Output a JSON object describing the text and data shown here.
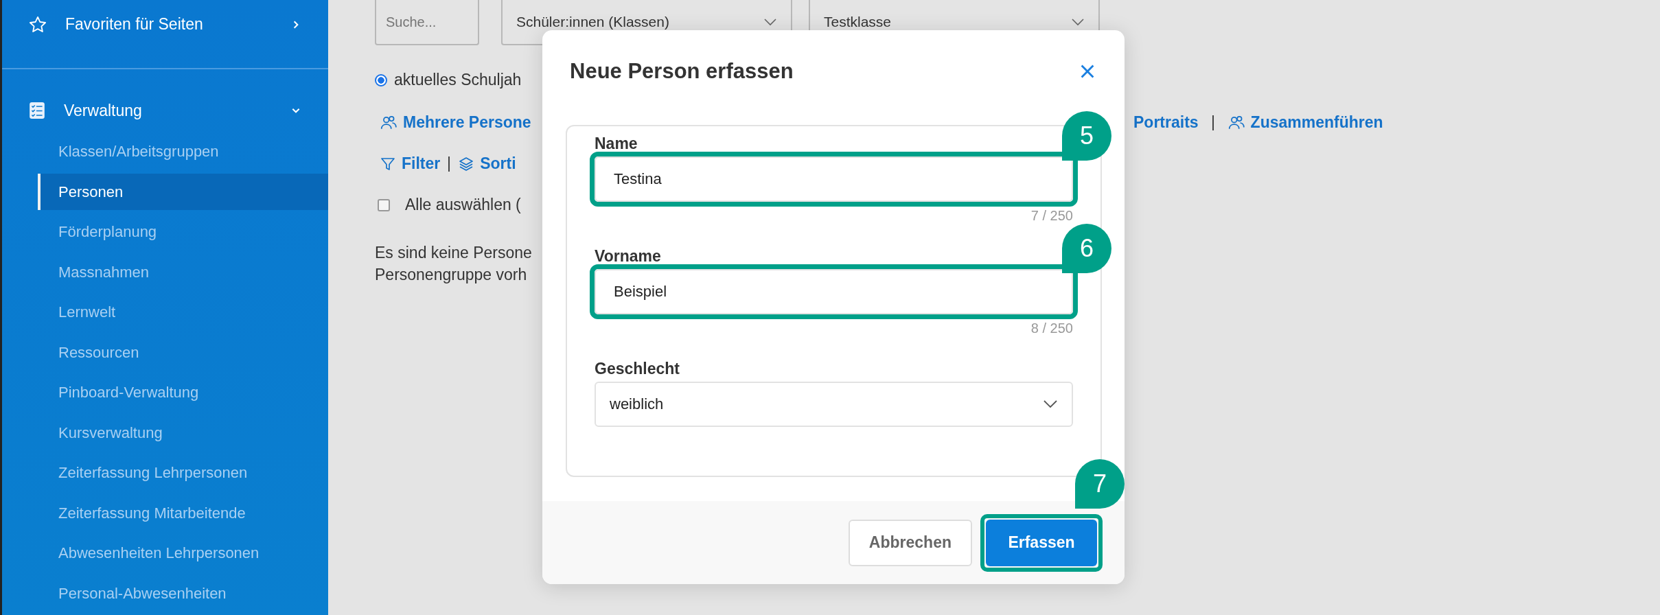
{
  "sidebar": {
    "groups": [
      {
        "label": "Favoriten für Seiten",
        "expanded": false
      },
      {
        "label": "Verwaltung",
        "expanded": true,
        "items": [
          {
            "label": "Klassen/Arbeitsgruppen",
            "selected": false
          },
          {
            "label": "Personen",
            "selected": true
          },
          {
            "label": "Förderplanung",
            "selected": false
          },
          {
            "label": "Massnahmen",
            "selected": false
          },
          {
            "label": "Lernwelt",
            "selected": false
          },
          {
            "label": "Ressourcen",
            "selected": false
          },
          {
            "label": "Pinboard-Verwaltung",
            "selected": false
          },
          {
            "label": "Kursverwaltung",
            "selected": false
          },
          {
            "label": "Zeiterfassung Lehrpersonen",
            "selected": false
          },
          {
            "label": "Zeiterfassung Mitarbeitende",
            "selected": false
          },
          {
            "label": "Abwesenheiten Lehrpersonen",
            "selected": false
          },
          {
            "label": "Personal-Abwesenheiten",
            "selected": false
          }
        ]
      }
    ]
  },
  "filters": {
    "search": {
      "placeholder": "Suche..."
    },
    "selects": [
      {
        "value": "Schüler:innen (Klassen)"
      },
      {
        "value": "Testklasse"
      }
    ]
  },
  "year_option": {
    "label": "aktuelles Schuljah",
    "selected": true
  },
  "actions_left": [
    {
      "label": "Mehrere Persone",
      "icon": true
    }
  ],
  "actions_right": [
    {
      "label": "Portraits",
      "icon": false
    },
    {
      "label": "Zusammenführen",
      "icon": true
    }
  ],
  "tools": [
    {
      "label": "Filter"
    },
    {
      "label": "Sorti"
    }
  ],
  "select_all": {
    "label": "Alle auswählen (",
    "checked": false
  },
  "empty_message": [
    "Es sind keine Persone",
    "Personengruppe vorh"
  ],
  "dialog": {
    "title": "Neue Person erfassen",
    "fields": [
      {
        "kind": "text",
        "label": "Name",
        "value": "Testina",
        "counter": "7 / 250",
        "highlighted": true,
        "callout": "5"
      },
      {
        "kind": "text",
        "label": "Vorname",
        "value": "Beispiel",
        "counter": "8 / 250",
        "highlighted": true,
        "callout": "6"
      },
      {
        "kind": "select",
        "label": "Geschlecht",
        "value": "weiblich",
        "highlighted": false
      }
    ],
    "buttons": [
      {
        "label": "Abbrechen",
        "kind": "secondary",
        "highlighted": false
      },
      {
        "label": "Erfassen",
        "kind": "primary",
        "highlighted": true,
        "callout": "7"
      }
    ]
  }
}
